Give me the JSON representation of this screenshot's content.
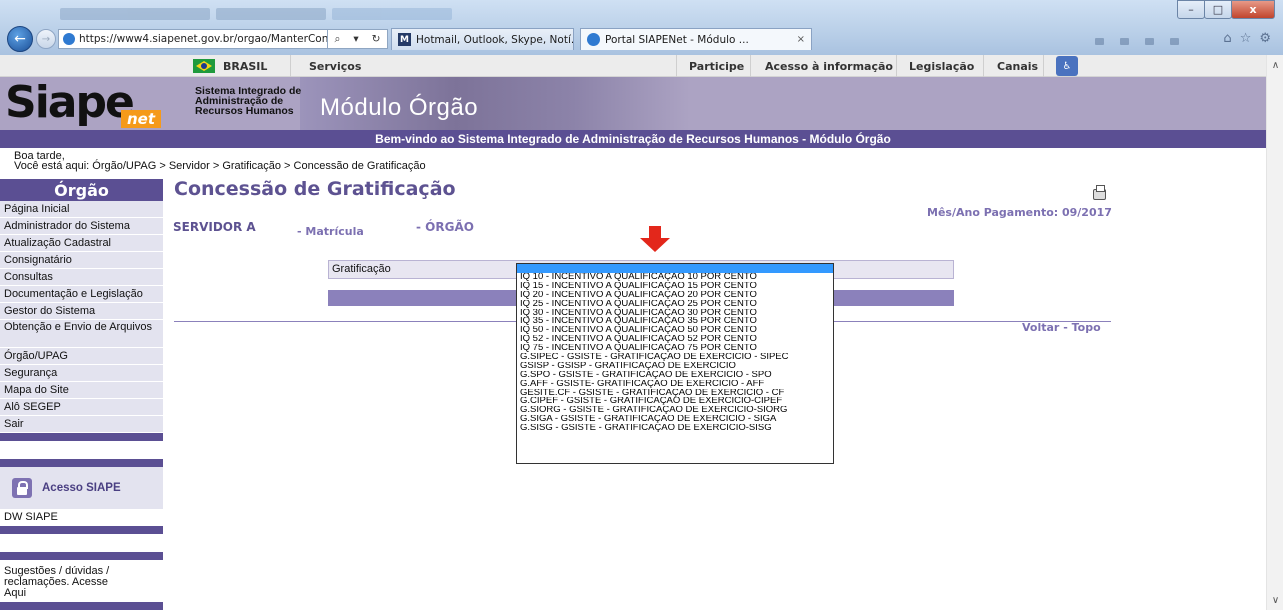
{
  "browser": {
    "url": "https://www4.siapenet.gov.br/orgao/ManterConce",
    "tabs": [
      {
        "label": "Hotmail, Outlook, Skype, Notí..."
      },
      {
        "label": "Portal SIAPENet - Módulo ...",
        "close": "×"
      }
    ]
  },
  "govbar": {
    "brasil": "BRASIL",
    "servicos": "Serviços",
    "participe": "Participe",
    "acesso": "Acesso à informação",
    "legislacao": "Legislação",
    "canais": "Canais"
  },
  "banner": {
    "logo": "Siape",
    "logo_net": "net",
    "tagline": [
      "Sistema Integrado de",
      "Administração de",
      "Recursos Humanos"
    ],
    "module": "Módulo Órgão",
    "welcome": "Bem-vindo ao Sistema Integrado de Administração de Recursos Humanos - Módulo Órgão"
  },
  "greeting": {
    "line1": "Boa tarde,",
    "prefix": "Você está aqui:",
    "path": "Órgão/UPAG > Servidor > Gratificação > Concessão de Gratificação"
  },
  "sidebar": {
    "title": "Órgão",
    "items": [
      "Página Inicial",
      "Administrador do Sistema",
      "Atualização Cadastral",
      "Consignatário",
      "Consultas",
      "Documentação e Legislação",
      "Gestor do Sistema",
      "Obtenção e Envio de Arquivos",
      "Órgão/UPAG",
      "Segurança",
      "Mapa do Site",
      "Alô SEGEP",
      "Sair"
    ],
    "acesso_siape": "Acesso SIAPE",
    "dw_siape": "DW SIAPE",
    "sugestoes": "Sugestões / dúvidas / reclamações. Acesse Aqui"
  },
  "main": {
    "title": "Concessão de Gratificação",
    "mes_ano": "Mês/Ano Pagamento: 09/2017",
    "servidor": "SERVIDOR A",
    "matricula": "- Matrícula",
    "orgao": "- ÓRGÃO",
    "gratificacao_label": "Gratificação",
    "voltar": "Voltar",
    "sep": "-",
    "topo": "Topo"
  },
  "dropdown": {
    "selected_index": 0,
    "options": [
      "",
      "IQ 10 - INCENTIVO A QUALIFICAÇÃO 10 POR CENTO",
      "IQ 15 - INCENTIVO A QUALIFICAÇÃO 15 POR CENTO",
      "IQ 20 - INCENTIVO A QUALIFICAÇÃO 20 POR CENTO",
      "IQ 25 - INCENTIVO A QUALIFICAÇÃO 25 POR CENTO",
      "IQ 30 - INCENTIVO A QUALIFICAÇÃO 30 POR CENTO",
      "IQ 35 - INCENTIVO A QUALIFICAÇÃO 35 POR CENTO",
      "IQ 50 - INCENTIVO A QUALIFICAÇÃO 50 POR CENTO",
      "IQ 52 - INCENTIVO A QUALIFICAÇÃO 52 POR CENTO",
      "IQ 75 - INCENTIVO A QUALIFICAÇÃO 75 POR CENTO",
      "G.SIPEC - GSISTE - GRATIFICAÇÃO DE EXERCÍCIO - SIPEC",
      "GSISP - GSISP - GRATIFICAÇÃO DE EXERCÍCIO",
      "G.SPO - GSISTE - GRATIFICAÇÃO DE EXERCÍCIO - SPO",
      "G.AFF - GSISTE- GRATIFICAÇÃO DE EXERCÍCIO - AFF",
      "GESITE.CF - GSISTE - GRATIFICAÇÃO DE EXERCÍCIO - CF",
      "G.CIPEF - GSISTE - GRATIFICAÇÃO DE EXERCÍCIO-CIPEF",
      "G.SIORG - GSISTE - GRATIFICAÇÃO DE EXERCÍCIO-SIORG",
      "G.SIGA - GSISTE - GRATIFICAÇÃO DE EXERCÍCIO - SIGA",
      "G.SISG - GSISTE - GRATIFICAÇÃO DE EXERCÍCIO-SISG"
    ]
  },
  "colors": {
    "accent": "#5b4f93",
    "link": "#7c70b1",
    "banner": "#aca3c3",
    "arrow": "#e3271b",
    "selected": "#3399ff"
  },
  "icons": [
    "back-arrow-icon",
    "forward-arrow-icon",
    "search-icon",
    "lock-icon",
    "refresh-icon",
    "home-icon",
    "star-icon",
    "gear-icon",
    "brazil-flag-icon",
    "print-icon",
    "padlock-icon",
    "down-arrow-icon"
  ]
}
